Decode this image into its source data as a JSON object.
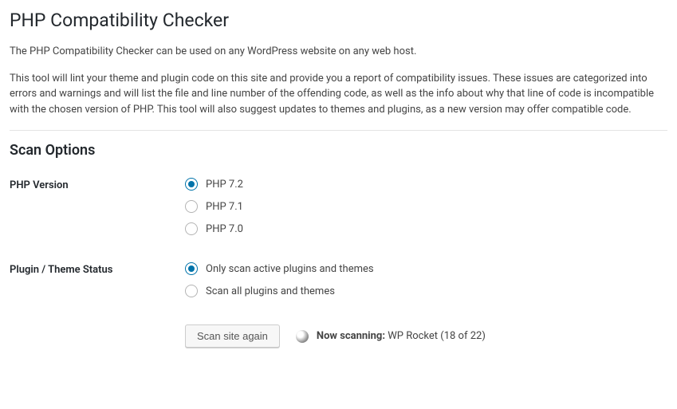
{
  "title": "PHP Compatibility Checker",
  "intro1": "The PHP Compatibility Checker can be used on any WordPress website on any web host.",
  "intro2": "This tool will lint your theme and plugin code on this site and provide you a report of compatibility issues. These issues are categorized into errors and warnings and will list the file and line number of the offending code, as well as the info about why that line of code is incompatible with the chosen version of PHP. This tool will also suggest updates to themes and plugins, as a new version may offer compatible code.",
  "scan_options_heading": "Scan Options",
  "php_version": {
    "label": "PHP Version",
    "options": [
      "PHP 7.2",
      "PHP 7.1",
      "PHP 7.0"
    ],
    "selected_index": 0
  },
  "plugin_status": {
    "label": "Plugin / Theme Status",
    "options": [
      "Only scan active plugins and themes",
      "Scan all plugins and themes"
    ],
    "selected_index": 0
  },
  "scan_button_label": "Scan site again",
  "scan_status": {
    "prefix": "Now scanning:",
    "current": "WP Rocket",
    "progress_current": 18,
    "progress_total": 22
  }
}
